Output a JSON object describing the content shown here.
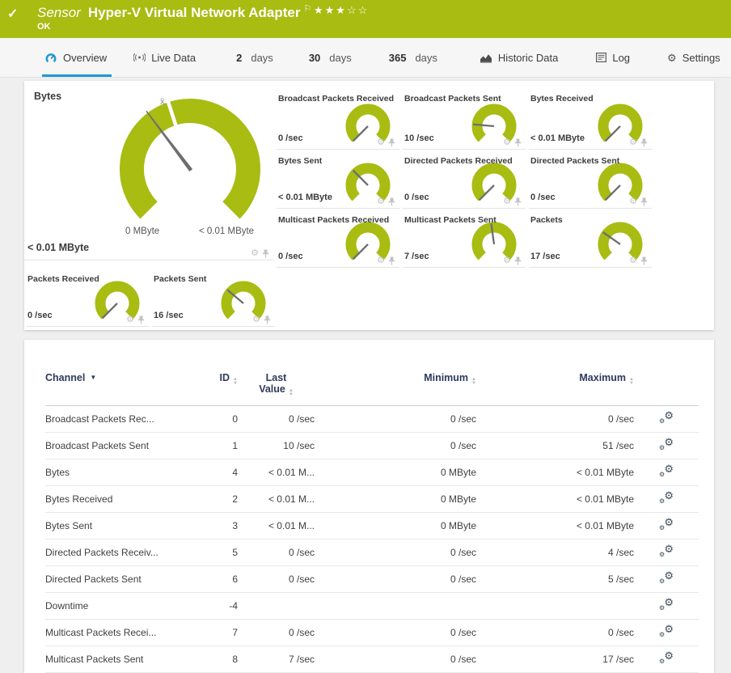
{
  "header": {
    "check_icon": "✓",
    "type_label": "Sensor",
    "title": "Hyper-V Virtual Network Adapter",
    "flag_icon": "⚐",
    "stars_filled": "★★★",
    "stars_empty": "☆☆",
    "status": "OK"
  },
  "tabs": {
    "overview": "Overview",
    "live_data": "Live Data",
    "days2_num": "2",
    "days2_word": "days",
    "days30_num": "30",
    "days30_word": "days",
    "days365_num": "365",
    "days365_word": "days",
    "historic": "Historic Data",
    "log": "Log",
    "settings": "Settings",
    "settings_gear_icon": "⚙"
  },
  "colors": {
    "brand_green": "#a8bc12",
    "tab_active_blue": "#1d9ad6",
    "needle_gray": "#6e6e6e"
  },
  "gauges": {
    "big": {
      "label": "Bytes",
      "value": "< 0.01 MByte",
      "min_label": "0 MByte",
      "max_label": "< 0.01 MByte",
      "avg_marker": "x̄",
      "needle_deg": -37
    },
    "small": [
      {
        "label": "Broadcast Packets Received",
        "value": "0 /sec",
        "needle_deg": -135
      },
      {
        "label": "Broadcast Packets Sent",
        "value": "10 /sec",
        "needle_deg": -85
      },
      {
        "label": "Bytes Received",
        "value": "< 0.01 MByte",
        "needle_deg": -135
      },
      {
        "label": "Bytes Sent",
        "value": "< 0.01 MByte",
        "needle_deg": -45
      },
      {
        "label": "Directed Packets Received",
        "value": "0 /sec",
        "needle_deg": -135
      },
      {
        "label": "Directed Packets Sent",
        "value": "0 /sec",
        "needle_deg": -135
      },
      {
        "label": "Multicast Packets Received",
        "value": "0 /sec",
        "needle_deg": -135
      },
      {
        "label": "Multicast Packets Sent",
        "value": "7 /sec",
        "needle_deg": -8
      },
      {
        "label": "Packets",
        "value": "17 /sec",
        "needle_deg": -55
      },
      {
        "label": "Packets Received",
        "value": "0 /sec",
        "needle_deg": -135
      },
      {
        "label": "Packets Sent",
        "value": "16 /sec",
        "needle_deg": -50
      }
    ],
    "gear_icon": "⚙"
  },
  "table": {
    "columns": {
      "channel": "Channel",
      "id": "ID",
      "last_line1": "Last",
      "last_line2": "Value",
      "minimum": "Minimum",
      "maximum": "Maximum"
    },
    "edit_gear_icon": "⚙",
    "rows": [
      {
        "channel": "Broadcast Packets Rec...",
        "id": "0",
        "last": "0 /sec",
        "min": "0 /sec",
        "max": "0 /sec"
      },
      {
        "channel": "Broadcast Packets Sent",
        "id": "1",
        "last": "10 /sec",
        "min": "0 /sec",
        "max": "51 /sec"
      },
      {
        "channel": "Bytes",
        "id": "4",
        "last": "< 0.01 M...",
        "min": "0 MByte",
        "max": "< 0.01 MByte"
      },
      {
        "channel": "Bytes Received",
        "id": "2",
        "last": "< 0.01 M...",
        "min": "0 MByte",
        "max": "< 0.01 MByte"
      },
      {
        "channel": "Bytes Sent",
        "id": "3",
        "last": "< 0.01 M...",
        "min": "0 MByte",
        "max": "< 0.01 MByte"
      },
      {
        "channel": "Directed Packets Receiv...",
        "id": "5",
        "last": "0 /sec",
        "min": "0 /sec",
        "max": "4 /sec"
      },
      {
        "channel": "Directed Packets Sent",
        "id": "6",
        "last": "0 /sec",
        "min": "0 /sec",
        "max": "5 /sec"
      },
      {
        "channel": "Downtime",
        "id": "-4",
        "last": "",
        "min": "",
        "max": ""
      },
      {
        "channel": "Multicast Packets Recei...",
        "id": "7",
        "last": "0 /sec",
        "min": "0 /sec",
        "max": "0 /sec"
      },
      {
        "channel": "Multicast Packets Sent",
        "id": "8",
        "last": "7 /sec",
        "min": "0 /sec",
        "max": "17 /sec"
      }
    ]
  }
}
